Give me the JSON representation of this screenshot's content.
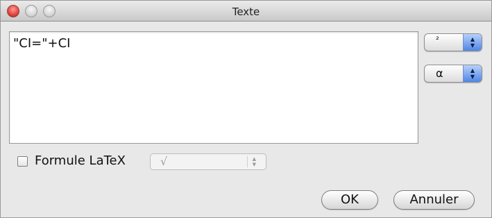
{
  "window": {
    "title": "Texte"
  },
  "editor": {
    "value": "\"CI=\"+CI"
  },
  "symbol_popups": {
    "superscript": {
      "selected": "²"
    },
    "greek": {
      "selected": "α"
    }
  },
  "latex": {
    "checkbox_label": "Formule LaTeX",
    "checked": false,
    "formula_popup_selected": "√"
  },
  "buttons": {
    "ok_label": "OK",
    "cancel_label": "Annuler"
  },
  "colors": {
    "accent_blue": "#4f86e6",
    "close_red": "#e0443e"
  }
}
